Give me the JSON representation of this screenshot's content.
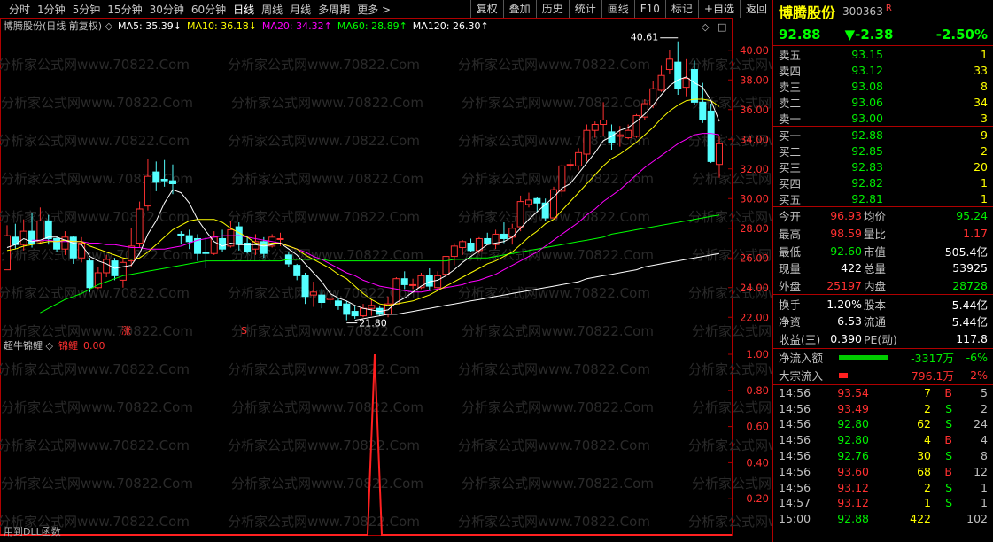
{
  "toolbar": {
    "periods": [
      "分时",
      "1分钟",
      "5分钟",
      "15分钟",
      "30分钟",
      "60分钟",
      "日线",
      "周线",
      "月线",
      "多周期",
      "更多 >"
    ],
    "active_period": "日线",
    "buttons": [
      "复权",
      "叠加",
      "历史",
      "统计",
      "画线",
      "F10",
      "标记",
      "+自选",
      "返回"
    ]
  },
  "main_legend": {
    "title": "博腾股份(日线 前复权) ◇",
    "ma5": "MA5: 35.39↓",
    "ma10": "MA10: 36.18↓",
    "ma20": "MA20: 34.32↑",
    "ma60": "MA60: 28.89↑",
    "ma120": "MA120: 26.30↑"
  },
  "sub_legend": {
    "title": "超牛锦鲤 ◇",
    "name": "锦鲤",
    "value": "0.00"
  },
  "bottom_note": "用到DLL函数",
  "watermark": "分析家公式网www.70822.Com",
  "markers": {
    "zhang": "涨",
    "s": "S"
  },
  "colors": {
    "up": "#ff3232",
    "down": "#54ffff",
    "ma5": "#ffffff",
    "ma10": "#ffff00",
    "ma20": "#ff00ff",
    "ma60": "#00ff00",
    "ma120": "#ffffff",
    "grid": "#8b0000"
  },
  "chart_data": [
    {
      "type": "candlestick",
      "title": "博腾股份(日线 前复权)",
      "ylim": [
        21,
        41
      ],
      "yticks": [
        "40.00",
        "38.00",
        "36.00",
        "34.00",
        "32.00",
        "30.00",
        "28.00",
        "26.00",
        "24.00",
        "22.00"
      ],
      "high_label": "40.61",
      "low_label": "21.80",
      "candles": [
        [
          25.2,
          27.5,
          28.2,
          25.2
        ],
        [
          27.4,
          26.9,
          28.3,
          26.6
        ],
        [
          26.9,
          27.8,
          28.6,
          26.5
        ],
        [
          27.8,
          27.0,
          29.0,
          26.7
        ],
        [
          27.1,
          28.5,
          29.4,
          27.0
        ],
        [
          28.5,
          27.3,
          28.9,
          26.9
        ],
        [
          27.3,
          26.6,
          27.5,
          26.4
        ],
        [
          26.6,
          27.4,
          27.8,
          26.2
        ],
        [
          27.4,
          26.0,
          27.5,
          25.6
        ],
        [
          26.0,
          27.0,
          27.4,
          25.7
        ],
        [
          25.8,
          24.0,
          26.0,
          23.7
        ],
        [
          24.0,
          25.0,
          25.4,
          23.9
        ],
        [
          25.0,
          25.9,
          26.2,
          24.7
        ],
        [
          25.8,
          24.8,
          26.0,
          24.5
        ],
        [
          24.5,
          25.7,
          25.9,
          24.0
        ],
        [
          25.8,
          26.8,
          28.0,
          25.4
        ],
        [
          27.0,
          29.3,
          29.8,
          26.7
        ],
        [
          29.5,
          31.5,
          32.7,
          29.2
        ],
        [
          31.8,
          31.1,
          32.5,
          30.5
        ],
        [
          31.3,
          31.2,
          32.6,
          30.8
        ],
        [
          31.2,
          31.0,
          32.3,
          30.3
        ],
        [
          27.6,
          27.5,
          27.8,
          26.9
        ],
        [
          27.5,
          27.1,
          27.9,
          26.6
        ],
        [
          27.3,
          26.3,
          27.6,
          25.8
        ],
        [
          26.4,
          26.3,
          27.4,
          25.3
        ],
        [
          26.3,
          27.4,
          27.8,
          26.2
        ],
        [
          27.3,
          26.6,
          27.9,
          26.4
        ],
        [
          26.8,
          27.9,
          28.5,
          26.7
        ],
        [
          28.1,
          26.9,
          28.4,
          26.5
        ],
        [
          27.0,
          26.4,
          27.5,
          26.3
        ],
        [
          26.6,
          27.1,
          27.6,
          26.2
        ],
        [
          27.1,
          26.3,
          27.4,
          26.0
        ],
        [
          26.8,
          27.4,
          27.6,
          26.7
        ],
        [
          27.3,
          27.3,
          27.7,
          26.8
        ],
        [
          26.2,
          25.6,
          26.4,
          25.4
        ],
        [
          25.5,
          24.8,
          25.6,
          24.5
        ],
        [
          24.8,
          23.4,
          25.0,
          22.9
        ],
        [
          23.5,
          23.7,
          24.4,
          22.7
        ],
        [
          23.5,
          23.0,
          23.9,
          22.6
        ],
        [
          23.2,
          23.3,
          23.6,
          22.9
        ],
        [
          23.1,
          22.8,
          23.3,
          22.5
        ],
        [
          22.9,
          22.2,
          23.1,
          21.8
        ],
        [
          22.4,
          22.1,
          22.8,
          21.9
        ],
        [
          22.1,
          22.6,
          22.9,
          22.0
        ],
        [
          22.6,
          22.8,
          23.2,
          22.1
        ],
        [
          22.6,
          22.2,
          22.8,
          22.1
        ],
        [
          22.2,
          22.9,
          23.4,
          22.0
        ],
        [
          22.9,
          24.6,
          24.7,
          22.9
        ],
        [
          24.6,
          24.2,
          25.1,
          23.9
        ],
        [
          24.2,
          24.2,
          24.6,
          23.9
        ],
        [
          24.0,
          24.8,
          25.0,
          23.9
        ],
        [
          24.8,
          24.1,
          25.3,
          23.8
        ],
        [
          24.0,
          24.8,
          25.1,
          23.9
        ],
        [
          24.9,
          26.1,
          26.4,
          24.7
        ],
        [
          26.1,
          26.8,
          27.0,
          25.5
        ],
        [
          26.7,
          27.1,
          27.2,
          26.2
        ],
        [
          27.0,
          26.5,
          27.3,
          26.4
        ],
        [
          26.5,
          27.3,
          27.4,
          26.3
        ],
        [
          27.3,
          27.0,
          27.7,
          26.9
        ],
        [
          26.9,
          27.6,
          27.9,
          26.6
        ],
        [
          27.6,
          27.3,
          28.4,
          27.0
        ],
        [
          27.4,
          28.0,
          28.3,
          26.9
        ],
        [
          28.1,
          29.8,
          30.2,
          27.8
        ],
        [
          29.6,
          29.9,
          30.4,
          29.4
        ],
        [
          30.0,
          29.7,
          30.1,
          29.1
        ],
        [
          29.7,
          28.7,
          30.0,
          28.5
        ],
        [
          28.7,
          30.6,
          30.8,
          28.7
        ],
        [
          30.5,
          32.2,
          32.3,
          30.1
        ],
        [
          32.3,
          32.3,
          32.7,
          31.9
        ],
        [
          32.2,
          33.1,
          33.4,
          31.9
        ],
        [
          33.0,
          34.6,
          35.0,
          32.5
        ],
        [
          34.6,
          35.0,
          35.2,
          34.1
        ],
        [
          35.0,
          35.3,
          36.5,
          34.2
        ],
        [
          34.5,
          33.8,
          35.0,
          33.3
        ],
        [
          34.2,
          34.3,
          34.9,
          33.5
        ],
        [
          34.1,
          34.6,
          35.0,
          34.0
        ],
        [
          34.2,
          35.6,
          35.7,
          34.1
        ],
        [
          35.5,
          36.4,
          36.7,
          35.3
        ],
        [
          36.3,
          37.4,
          37.9,
          36.1
        ],
        [
          37.3,
          38.3,
          39.0,
          37.2
        ],
        [
          38.7,
          39.4,
          40.0,
          38.4
        ],
        [
          39.2,
          37.4,
          40.6,
          37.0
        ],
        [
          37.5,
          38.1,
          39.4,
          36.9
        ],
        [
          38.7,
          36.5,
          39.3,
          36.3
        ],
        [
          36.5,
          35.3,
          37.8,
          35.1
        ],
        [
          35.9,
          32.5,
          36.4,
          32.4
        ],
        [
          32.3,
          33.7,
          34.2,
          31.4
        ]
      ],
      "ma5": [
        26.7,
        26.9,
        27.3,
        27.1,
        27.2,
        27.4,
        27.4,
        27.2,
        27.0,
        26.9,
        26.1,
        25.8,
        25.6,
        25.3,
        25.4,
        25.5,
        26.3,
        27.6,
        28.5,
        29.7,
        30.6,
        30.4,
        29.7,
        28.6,
        27.8,
        27.1,
        26.8,
        27.0,
        26.9,
        26.9,
        26.9,
        26.8,
        26.9,
        27.0,
        26.6,
        26.2,
        25.6,
        25.0,
        24.4,
        23.6,
        23.3,
        23.1,
        22.8,
        22.6,
        22.5,
        22.4,
        22.5,
        23.0,
        23.3,
        23.7,
        24.1,
        24.4,
        24.5,
        24.8,
        25.2,
        25.7,
        26.1,
        26.5,
        26.9,
        27.0,
        27.1,
        27.4,
        28.0,
        28.6,
        29.1,
        29.6,
        30.1,
        30.7,
        31.0,
        31.7,
        32.4,
        33.1,
        33.9,
        34.2,
        34.6,
        34.8,
        35.2,
        35.7,
        36.3,
        37.0,
        37.6,
        38.0,
        38.2,
        37.8,
        37.5,
        36.6,
        35.2
      ],
      "ma10": [
        26.5,
        26.6,
        26.8,
        26.9,
        27.0,
        27.1,
        27.1,
        27.2,
        27.1,
        27.1,
        26.8,
        26.6,
        26.4,
        26.2,
        26.0,
        25.9,
        26.0,
        26.4,
        26.9,
        27.4,
        27.9,
        28.2,
        28.5,
        28.6,
        28.6,
        28.6,
        28.4,
        28.0,
        27.7,
        27.4,
        27.0,
        26.9,
        27.0,
        27.0,
        26.8,
        26.6,
        26.2,
        25.9,
        25.6,
        25.3,
        24.9,
        24.6,
        24.1,
        23.6,
        23.2,
        22.9,
        22.8,
        22.9,
        23.0,
        23.1,
        23.3,
        23.5,
        23.8,
        24.1,
        24.4,
        24.7,
        25.0,
        25.3,
        25.6,
        25.8,
        26.1,
        26.4,
        26.9,
        27.4,
        27.8,
        28.3,
        28.6,
        29.2,
        29.8,
        30.4,
        31.0,
        31.6,
        32.2,
        32.7,
        33.0,
        33.4,
        33.8,
        34.3,
        34.8,
        35.4,
        35.9,
        36.3,
        36.6,
        36.7,
        36.7,
        36.6,
        36.2
      ],
      "ma20": [
        27.2,
        27.2,
        27.2,
        27.1,
        27.1,
        27.1,
        27.1,
        27.0,
        27.0,
        26.9,
        26.9,
        26.8,
        26.7,
        26.7,
        26.6,
        26.6,
        26.6,
        26.7,
        26.8,
        27.0,
        27.2,
        27.3,
        27.4,
        27.5,
        27.5,
        27.5,
        27.4,
        27.3,
        27.2,
        27.1,
        27.0,
        26.8,
        26.6,
        26.4,
        26.1,
        25.9,
        25.6,
        25.3,
        25.0,
        24.8,
        24.5,
        24.3,
        24.1,
        24.0,
        23.9,
        23.8,
        23.7,
        23.7,
        23.8,
        23.9,
        24.0,
        24.1,
        24.2,
        24.4,
        24.5,
        24.7,
        24.9,
        25.2,
        25.5,
        25.8,
        26.1,
        26.4,
        26.8,
        27.2,
        27.6,
        28.0,
        28.4,
        28.9,
        29.3,
        29.8,
        30.2,
        30.6,
        31.1,
        31.6,
        32.1,
        32.5,
        32.9,
        33.3,
        33.7,
        34.0,
        34.3,
        34.4,
        34.4,
        34.3
      ],
      "ma60": [
        22.3,
        22.6,
        22.9,
        23.2,
        23.4,
        23.6,
        23.9,
        24.2,
        24.4,
        24.6,
        24.8,
        24.9,
        25.0,
        25.1,
        25.2,
        25.3,
        25.4,
        25.5,
        25.6,
        25.7,
        25.8,
        25.8,
        25.8,
        25.8,
        25.8,
        25.8,
        25.8,
        25.8,
        25.8,
        25.8,
        25.9,
        25.9,
        25.9,
        25.9,
        25.9,
        25.8,
        25.8,
        25.8,
        25.8,
        25.8,
        25.8,
        25.8,
        25.8,
        25.8,
        25.8,
        25.8,
        25.8,
        25.8,
        25.8,
        25.8,
        25.9,
        25.9,
        26.0,
        26.0,
        26.0,
        26.1,
        26.2,
        26.3,
        26.4,
        26.5,
        26.6,
        26.7,
        26.8,
        26.9,
        27.0,
        27.1,
        27.2,
        27.3,
        27.4,
        27.6,
        27.7,
        27.8,
        27.9,
        28.0,
        28.1,
        28.2,
        28.3,
        28.4,
        28.5,
        28.6,
        28.7,
        28.8,
        28.9
      ],
      "ma120": [
        21.8,
        21.9,
        22.0,
        22.1,
        22.2,
        22.2,
        22.3,
        22.4,
        22.5,
        22.6,
        22.7,
        22.8,
        22.9,
        23.0,
        23.1,
        23.2,
        23.3,
        23.4,
        23.5,
        23.6,
        23.7,
        23.8,
        23.9,
        24.0,
        24.1,
        24.2,
        24.3,
        24.4,
        24.6,
        24.7,
        24.8,
        24.9,
        25.0,
        25.1,
        25.2,
        25.4,
        25.5,
        25.6,
        25.7,
        25.8,
        25.9,
        26.0,
        26.1,
        26.2,
        26.3
      ],
      "ma60_start": 4,
      "ma120_start": 42
    },
    {
      "type": "line",
      "title": "超牛锦鲤",
      "series": [
        {
          "name": "锦鲤",
          "values": [
            0,
            0,
            0,
            0,
            1,
            0,
            0
          ]
        }
      ],
      "x": [
        0,
        1,
        2,
        3,
        4,
        5,
        6
      ],
      "yticks": [
        "1.00",
        "0.80",
        "0.60",
        "0.40",
        "0.20"
      ],
      "ylim": [
        0,
        1
      ]
    }
  ],
  "quote": {
    "name": "博腾股份",
    "code": "300363",
    "r_badge": "R",
    "price": "92.88",
    "change": "▼-2.38",
    "change_pct": "-2.50%",
    "asks": [
      {
        "label": "卖五",
        "price": "93.15",
        "vol": "1"
      },
      {
        "label": "卖四",
        "price": "93.12",
        "vol": "33"
      },
      {
        "label": "卖三",
        "price": "93.08",
        "vol": "8"
      },
      {
        "label": "卖二",
        "price": "93.06",
        "vol": "34"
      },
      {
        "label": "卖一",
        "price": "93.00",
        "vol": "3"
      }
    ],
    "bids": [
      {
        "label": "买一",
        "price": "92.88",
        "vol": "9"
      },
      {
        "label": "买二",
        "price": "92.85",
        "vol": "2"
      },
      {
        "label": "买三",
        "price": "92.83",
        "vol": "20"
      },
      {
        "label": "买四",
        "price": "92.82",
        "vol": "1"
      },
      {
        "label": "买五",
        "price": "92.81",
        "vol": "1"
      }
    ],
    "stats1": [
      {
        "l1": "今开",
        "v1": "96.93",
        "c1": "red",
        "l2": "均价",
        "v2": "95.24",
        "c2": "green"
      },
      {
        "l1": "最高",
        "v1": "98.59",
        "c1": "red",
        "l2": "量比",
        "v2": "1.17",
        "c2": "red"
      },
      {
        "l1": "最低",
        "v1": "92.60",
        "c1": "green",
        "l2": "市值",
        "v2": "505.4亿",
        "c2": "white"
      },
      {
        "l1": "现量",
        "v1": "422",
        "c1": "white",
        "l2": "总量",
        "v2": "53925",
        "c2": "white"
      },
      {
        "l1": "外盘",
        "v1": "25197",
        "c1": "red",
        "l2": "内盘",
        "v2": "28728",
        "c2": "green"
      }
    ],
    "stats2": [
      {
        "l1": "换手",
        "v1": "1.20%",
        "c1": "white",
        "l2": "股本",
        "v2": "5.44亿",
        "c2": "white"
      },
      {
        "l1": "净资",
        "v1": "6.53",
        "c1": "white",
        "l2": "流通",
        "v2": "5.44亿",
        "c2": "white"
      },
      {
        "l1": "收益(三)",
        "v1": "0.390",
        "c1": "white",
        "l2": "PE(动)",
        "v2": "117.8",
        "c2": "white"
      }
    ],
    "flows": [
      {
        "label": "净流入额",
        "value": "-3317万",
        "pct": "-6%",
        "color": "green",
        "bar_fraction": 0.77
      },
      {
        "label": "大宗流入",
        "value": "796.1万",
        "pct": "2%",
        "color": "red",
        "bar_fraction": 0.14
      }
    ],
    "ticks": [
      {
        "time": "14:56",
        "price": "93.54",
        "pc": "red",
        "vol": "7",
        "dir": "B",
        "dc": "red",
        "n": "5"
      },
      {
        "time": "14:56",
        "price": "93.49",
        "pc": "red",
        "vol": "2",
        "dir": "S",
        "dc": "green",
        "n": "2"
      },
      {
        "time": "14:56",
        "price": "92.80",
        "pc": "green",
        "vol": "62",
        "dir": "S",
        "dc": "green",
        "n": "24"
      },
      {
        "time": "14:56",
        "price": "92.80",
        "pc": "green",
        "vol": "4",
        "dir": "B",
        "dc": "red",
        "n": "4"
      },
      {
        "time": "14:56",
        "price": "92.76",
        "pc": "green",
        "vol": "30",
        "dir": "S",
        "dc": "green",
        "n": "8"
      },
      {
        "time": "14:56",
        "price": "93.60",
        "pc": "red",
        "vol": "68",
        "dir": "B",
        "dc": "red",
        "n": "12"
      },
      {
        "time": "14:56",
        "price": "93.12",
        "pc": "red",
        "vol": "2",
        "dir": "S",
        "dc": "green",
        "n": "1"
      },
      {
        "time": "14:57",
        "price": "93.12",
        "pc": "red",
        "vol": "1",
        "dir": "S",
        "dc": "green",
        "n": "1"
      },
      {
        "time": "15:00",
        "price": "92.88",
        "pc": "green",
        "vol": "422",
        "dir": "",
        "dc": "",
        "n": "102"
      }
    ]
  }
}
